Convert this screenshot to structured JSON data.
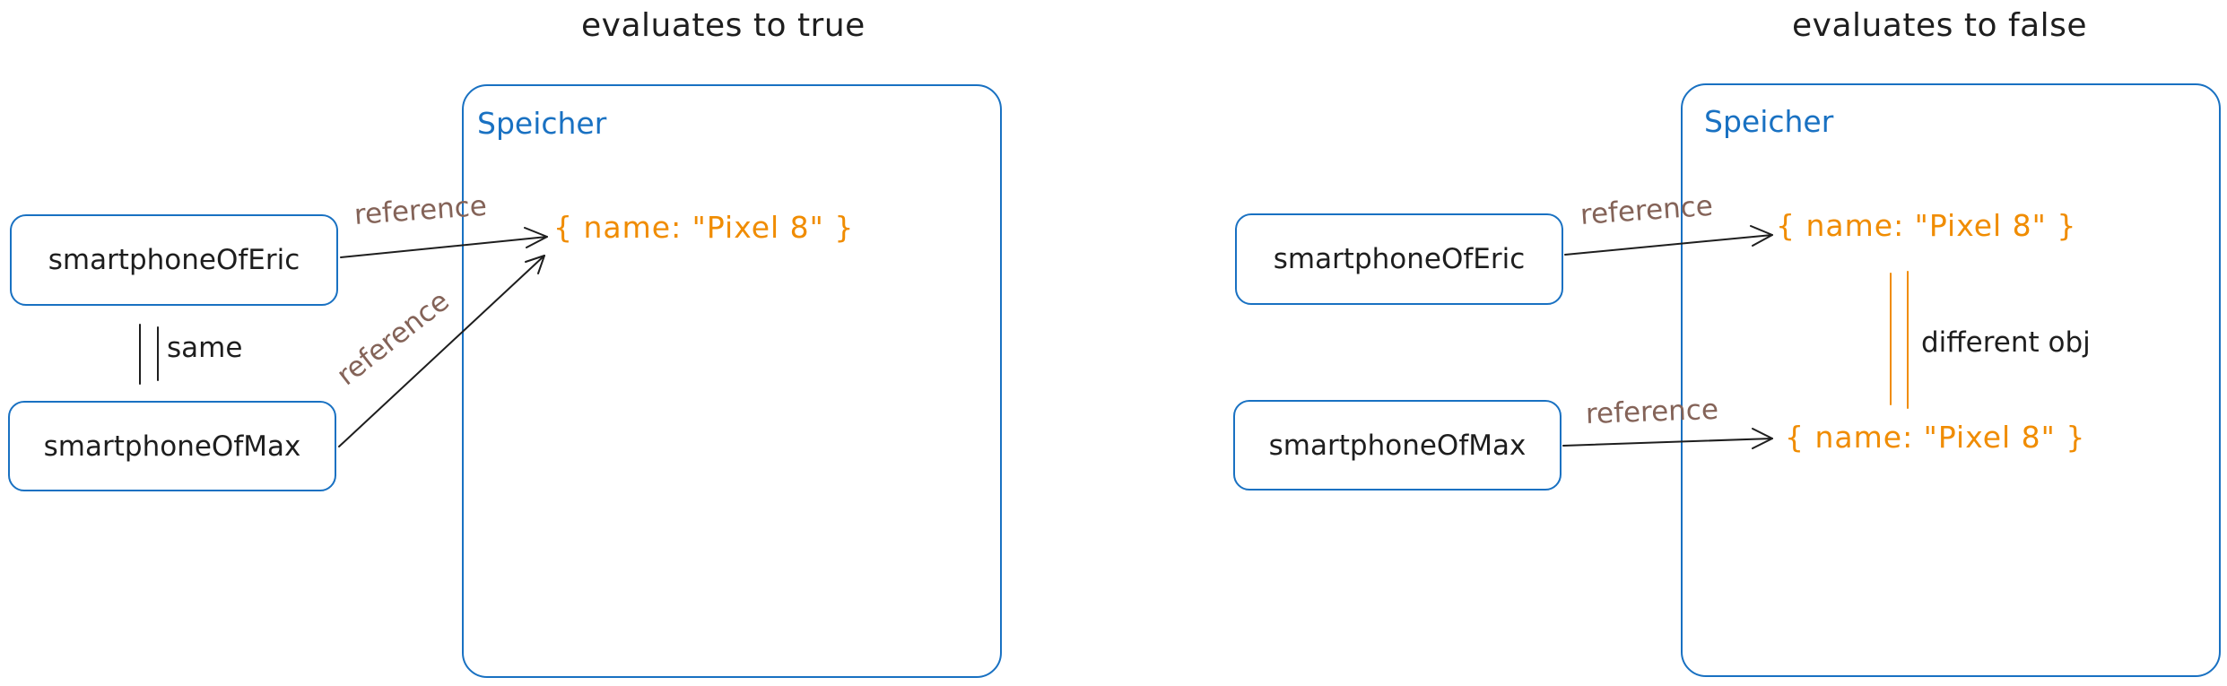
{
  "diagrams": [
    {
      "title": "evaluates to true",
      "memory_label": "Speicher",
      "variables": [
        "smartphoneOfEric",
        "smartphoneOfMax"
      ],
      "objects": [
        "{ name: \"Pixel 8\" }"
      ],
      "reference_labels": [
        "reference",
        "reference"
      ],
      "comparison_label": "same"
    },
    {
      "title": "evaluates to false",
      "memory_label": "Speicher",
      "variables": [
        "smartphoneOfEric",
        "smartphoneOfMax"
      ],
      "objects": [
        "{ name: \"Pixel 8\" }",
        "{ name: \"Pixel 8\" }"
      ],
      "reference_labels": [
        "reference",
        "reference"
      ],
      "comparison_label": "different obj"
    }
  ],
  "colors": {
    "container_stroke": "#1971c2",
    "object_text": "#f08c00",
    "reference_text": "#846358",
    "text": "#1e1e1e"
  }
}
